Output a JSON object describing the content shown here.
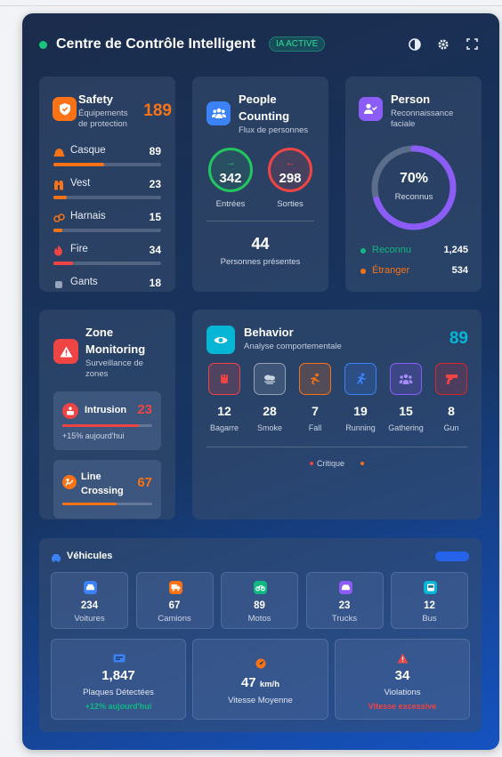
{
  "header": {
    "title": "Centre de Contrôle Intelligent",
    "ai_badge": "IA ACTIVE",
    "icons": [
      "theme-icon",
      "gear-icon",
      "fullscreen-icon"
    ]
  },
  "safety": {
    "title": "Safety",
    "subtitle_line1": "Équipements",
    "subtitle_line2": "de protection",
    "total": "189",
    "items": [
      {
        "label": "Casque",
        "value": "89",
        "fill": 0.47,
        "color": "#f97316",
        "icon": "helmet-icon"
      },
      {
        "label": "Vest",
        "value": "23",
        "fill": 0.12,
        "color": "#f97316",
        "icon": "vest-icon"
      },
      {
        "label": "Harnais",
        "value": "15",
        "fill": 0.08,
        "color": "#f97316",
        "icon": "harness-icon"
      },
      {
        "label": "Fire",
        "value": "34",
        "fill": 0.18,
        "color": "#ef4444",
        "icon": "fire-icon"
      },
      {
        "label": "Gants",
        "value": "18",
        "fill": 0.1,
        "color": "#f97316",
        "icon": "glove-icon"
      }
    ]
  },
  "people": {
    "title_line1": "People",
    "title_line2": "Counting",
    "subtitle": "Flux de personnes",
    "in_value": "342",
    "in_label": "Entrées",
    "out_value": "298",
    "out_label": "Sorties",
    "present_value": "44",
    "present_label": "Personnes présentes"
  },
  "person": {
    "title": "Person",
    "subtitle_line1": "Reconnaissance",
    "subtitle_line2": "faciale",
    "percent": "70%",
    "percent_value": 0.7,
    "percent_label": "Reconnus",
    "known_label": "Reconnu",
    "known_value": "1,245",
    "unknown_label": "Étranger",
    "unknown_value": "534"
  },
  "zone": {
    "title_line1": "Zone",
    "title_line2": "Monitoring",
    "subtitle_line1": "Surveillance de",
    "subtitle_line2": "zones",
    "intrusion_label": "Intrusion",
    "intrusion_value": "23",
    "intrusion_fill": 0.85,
    "intrusion_trend": "+15% aujourd'hui",
    "line_label_1": "Line",
    "line_label_2": "Crossing",
    "line_value": "67",
    "line_fill": 0.6
  },
  "behavior": {
    "title": "Behavior",
    "subtitle": "Analyse comportementale",
    "total": "89",
    "legend_critical": "Critique",
    "items": [
      {
        "label": "Bagarre",
        "value": "12",
        "color": "#ef4444"
      },
      {
        "label": "Smoke",
        "value": "28",
        "color": "#94a3b8"
      },
      {
        "label": "Fall",
        "value": "7",
        "color": "#f97316"
      },
      {
        "label": "Running",
        "value": "19",
        "color": "#3b82f6"
      },
      {
        "label": "Gathering",
        "value": "15",
        "color": "#8b5cf6"
      },
      {
        "label": "Gun",
        "value": "8",
        "color": "#dc2626"
      }
    ]
  },
  "vehicles": {
    "title": "Véhicules",
    "items": [
      {
        "label": "Voitures",
        "value": "234",
        "color": "#3b82f6"
      },
      {
        "label": "Camions",
        "value": "67",
        "color": "#f97316"
      },
      {
        "label": "Motos",
        "value": "89",
        "color": "#10b981"
      },
      {
        "label": "Trucks",
        "value": "23",
        "color": "#8b5cf6"
      },
      {
        "label": "Bus",
        "value": "12",
        "color": "#06b6d4"
      }
    ],
    "plates_value": "1,847",
    "plates_label": "Plaques Détectées",
    "plates_trend": "+12% aujourd'hui",
    "speed_value": "47",
    "speed_unit": "km/h",
    "speed_label": "Vitesse Moyenne",
    "violations_value": "34",
    "violations_label": "Violations",
    "violations_note": "Vitesse excessive"
  }
}
